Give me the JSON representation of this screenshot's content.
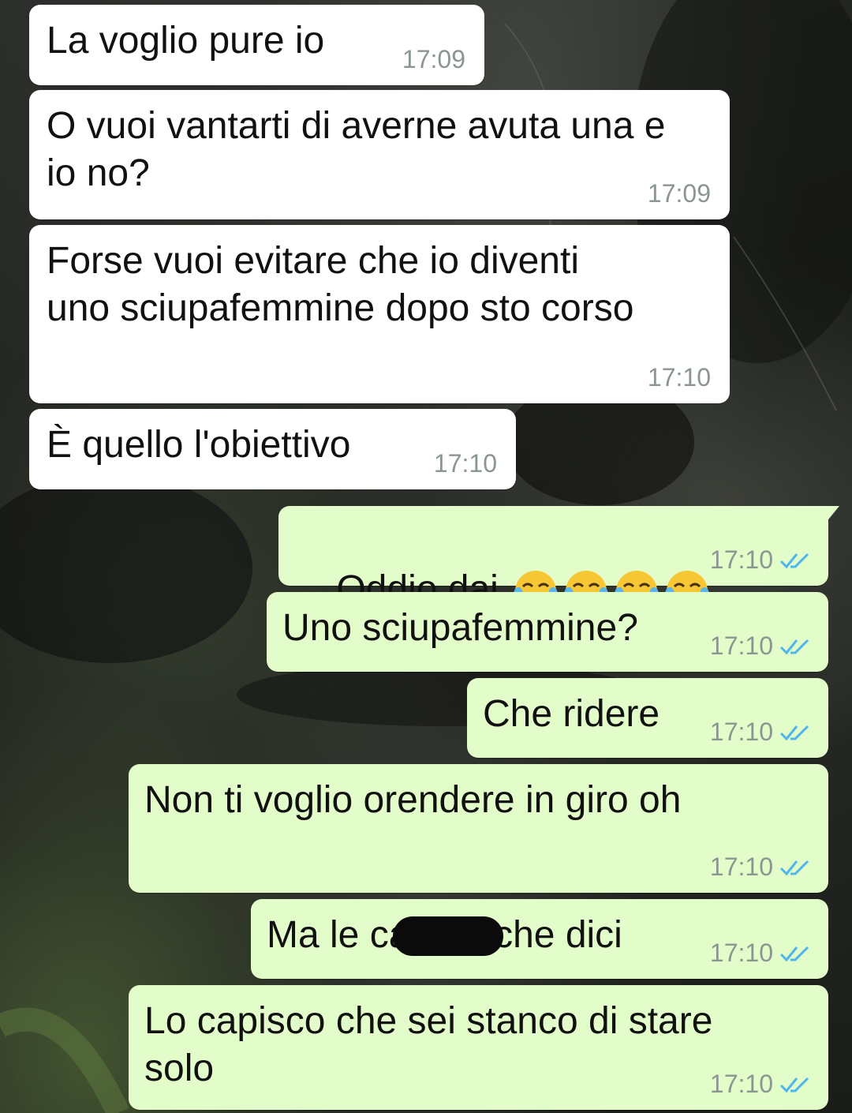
{
  "messages": [
    {
      "text": "La voglio pure io",
      "time": "17:09"
    },
    {
      "text": "O vuoi vantarti di averne avuta una e\nio no?",
      "time": "17:09"
    },
    {
      "text": "Forse vuoi evitare che io diventi\nuno sciupafemmine dopo sto corso",
      "time": "17:10"
    },
    {
      "text": "È quello l'obiettivo",
      "time": "17:10"
    },
    {
      "text": "Oddio dai ",
      "emoji": [
        "face-with-tears-of-joy",
        "face-with-tears-of-joy",
        "face-with-tears-of-joy",
        "face-with-tears-of-joy"
      ],
      "time": "17:10"
    },
    {
      "text": "Uno sciupafemmine?",
      "time": "17:10"
    },
    {
      "text": "Che ridere",
      "time": "17:10"
    },
    {
      "text": "Non ti voglio orendere in giro oh",
      "time": "17:10"
    },
    {
      "text": "Ma le ca        che dici",
      "time": "17:10"
    },
    {
      "text": "Lo capisco che sei stanco di stare\nsolo",
      "time": "17:10"
    }
  ],
  "colors": {
    "incoming_bubble": "#ffffff",
    "outgoing_bubble": "#e2fdc9",
    "read_ticks": "#4fb6ec",
    "timestamp": "#8c9690"
  },
  "icons": {
    "read_receipt": "double-check-icon",
    "emoji": "face-with-tears-of-joy"
  }
}
